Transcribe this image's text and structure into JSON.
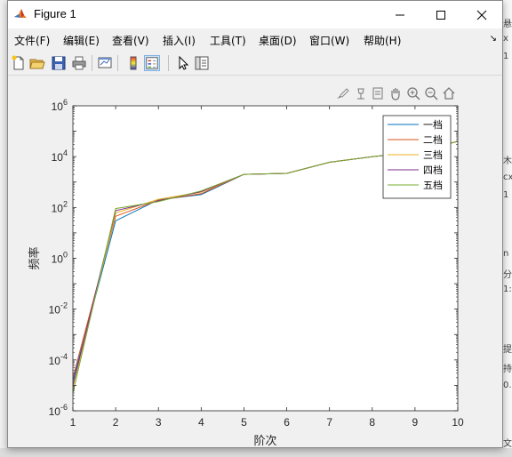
{
  "window": {
    "title": "Figure 1"
  },
  "menu": [
    "文件(F)",
    "编辑(E)",
    "查看(V)",
    "插入(I)",
    "工具(T)",
    "桌面(D)",
    "窗口(W)",
    "帮助(H)"
  ],
  "background_right": [
    "悬",
    "x",
    "1",
    "木",
    "cx",
    "1",
    "n",
    "分",
    "1:",
    "提",
    "持",
    "0.",
    "文"
  ],
  "chart_data": {
    "type": "line",
    "x": [
      1,
      2,
      3,
      4,
      5,
      6,
      7,
      8,
      9,
      10
    ],
    "xlabel": "阶次",
    "ylabel": "频率",
    "xlim": [
      1,
      10
    ],
    "ylim": [
      1e-06,
      1000000.0
    ],
    "yscale": "log",
    "xticks": [
      "1",
      "2",
      "3",
      "4",
      "5",
      "6",
      "7",
      "8",
      "9",
      "10"
    ],
    "yticks": [
      {
        "base": "10",
        "exp": "-6"
      },
      {
        "base": "10",
        "exp": "-4"
      },
      {
        "base": "10",
        "exp": "-2"
      },
      {
        "base": "10",
        "exp": "0"
      },
      {
        "base": "10",
        "exp": "2"
      },
      {
        "base": "10",
        "exp": "4"
      },
      {
        "base": "10",
        "exp": "6"
      }
    ],
    "legend_position": "top-right",
    "series": [
      {
        "name": "一档",
        "color": "#0072BD",
        "values": [
          1.5e-05,
          30,
          200,
          320,
          2000,
          2200,
          6000,
          10000,
          15000,
          40000
        ]
      },
      {
        "name": "二档",
        "color": "#D95319",
        "values": [
          2e-05,
          45,
          190,
          350,
          2000,
          2200,
          6000,
          10000,
          15000,
          40000
        ]
      },
      {
        "name": "三档",
        "color": "#EDB120",
        "values": [
          8e-06,
          60,
          210,
          400,
          2000,
          2200,
          6000,
          10000,
          15000,
          40000
        ]
      },
      {
        "name": "四档",
        "color": "#7E2F8E",
        "values": [
          1e-05,
          75,
          180,
          420,
          2000,
          2200,
          6000,
          10000,
          15000,
          40000
        ]
      },
      {
        "name": "五档",
        "color": "#77AC30",
        "values": [
          5e-06,
          90,
          170,
          450,
          2000,
          2200,
          6000,
          10000,
          15000,
          40000
        ]
      }
    ]
  }
}
